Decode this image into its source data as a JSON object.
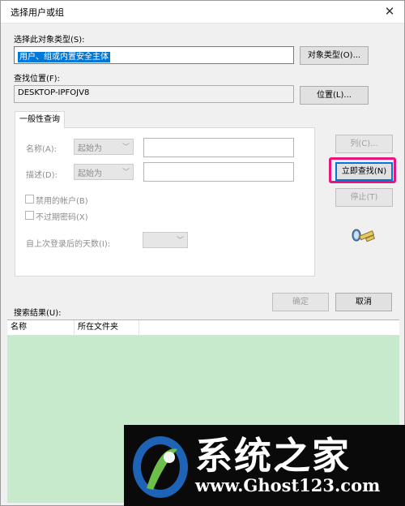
{
  "window": {
    "title": "选择用户或组",
    "close_glyph": "✕"
  },
  "object_type": {
    "label": "选择此对象类型(S):",
    "value": "用户、组或内置安全主体",
    "button": "对象类型(O)..."
  },
  "location": {
    "label": "查找位置(F):",
    "value": "DESKTOP-IPFOJV8",
    "button": "位置(L)..."
  },
  "query_tab": {
    "label": "一般性查询",
    "name_label": "名称(A):",
    "name_mode": "起始为",
    "desc_label": "描述(D):",
    "desc_mode": "起始为",
    "disabled_accounts": "禁用的帐户(B)",
    "no_expire_password": "不过期密码(X)",
    "days_since_login": "自上次登录后的天数(I):"
  },
  "side_buttons": {
    "columns": "列(C)...",
    "find_now": "立即查找(N)",
    "stop": "停止(T)"
  },
  "icon_names": {
    "search": "search-people-icon",
    "chevron": "chevron-down-icon"
  },
  "footer": {
    "ok": "确定",
    "cancel": "取消"
  },
  "results": {
    "label": "搜索结果(U):",
    "columns": [
      "名称",
      "所在文件夹"
    ]
  },
  "watermark": {
    "brand": "系统之家",
    "url": "www.Ghost123.com"
  },
  "colors": {
    "results_bg": "#c6eacb",
    "highlight": "#e8157a",
    "selection": "#0078d7"
  }
}
